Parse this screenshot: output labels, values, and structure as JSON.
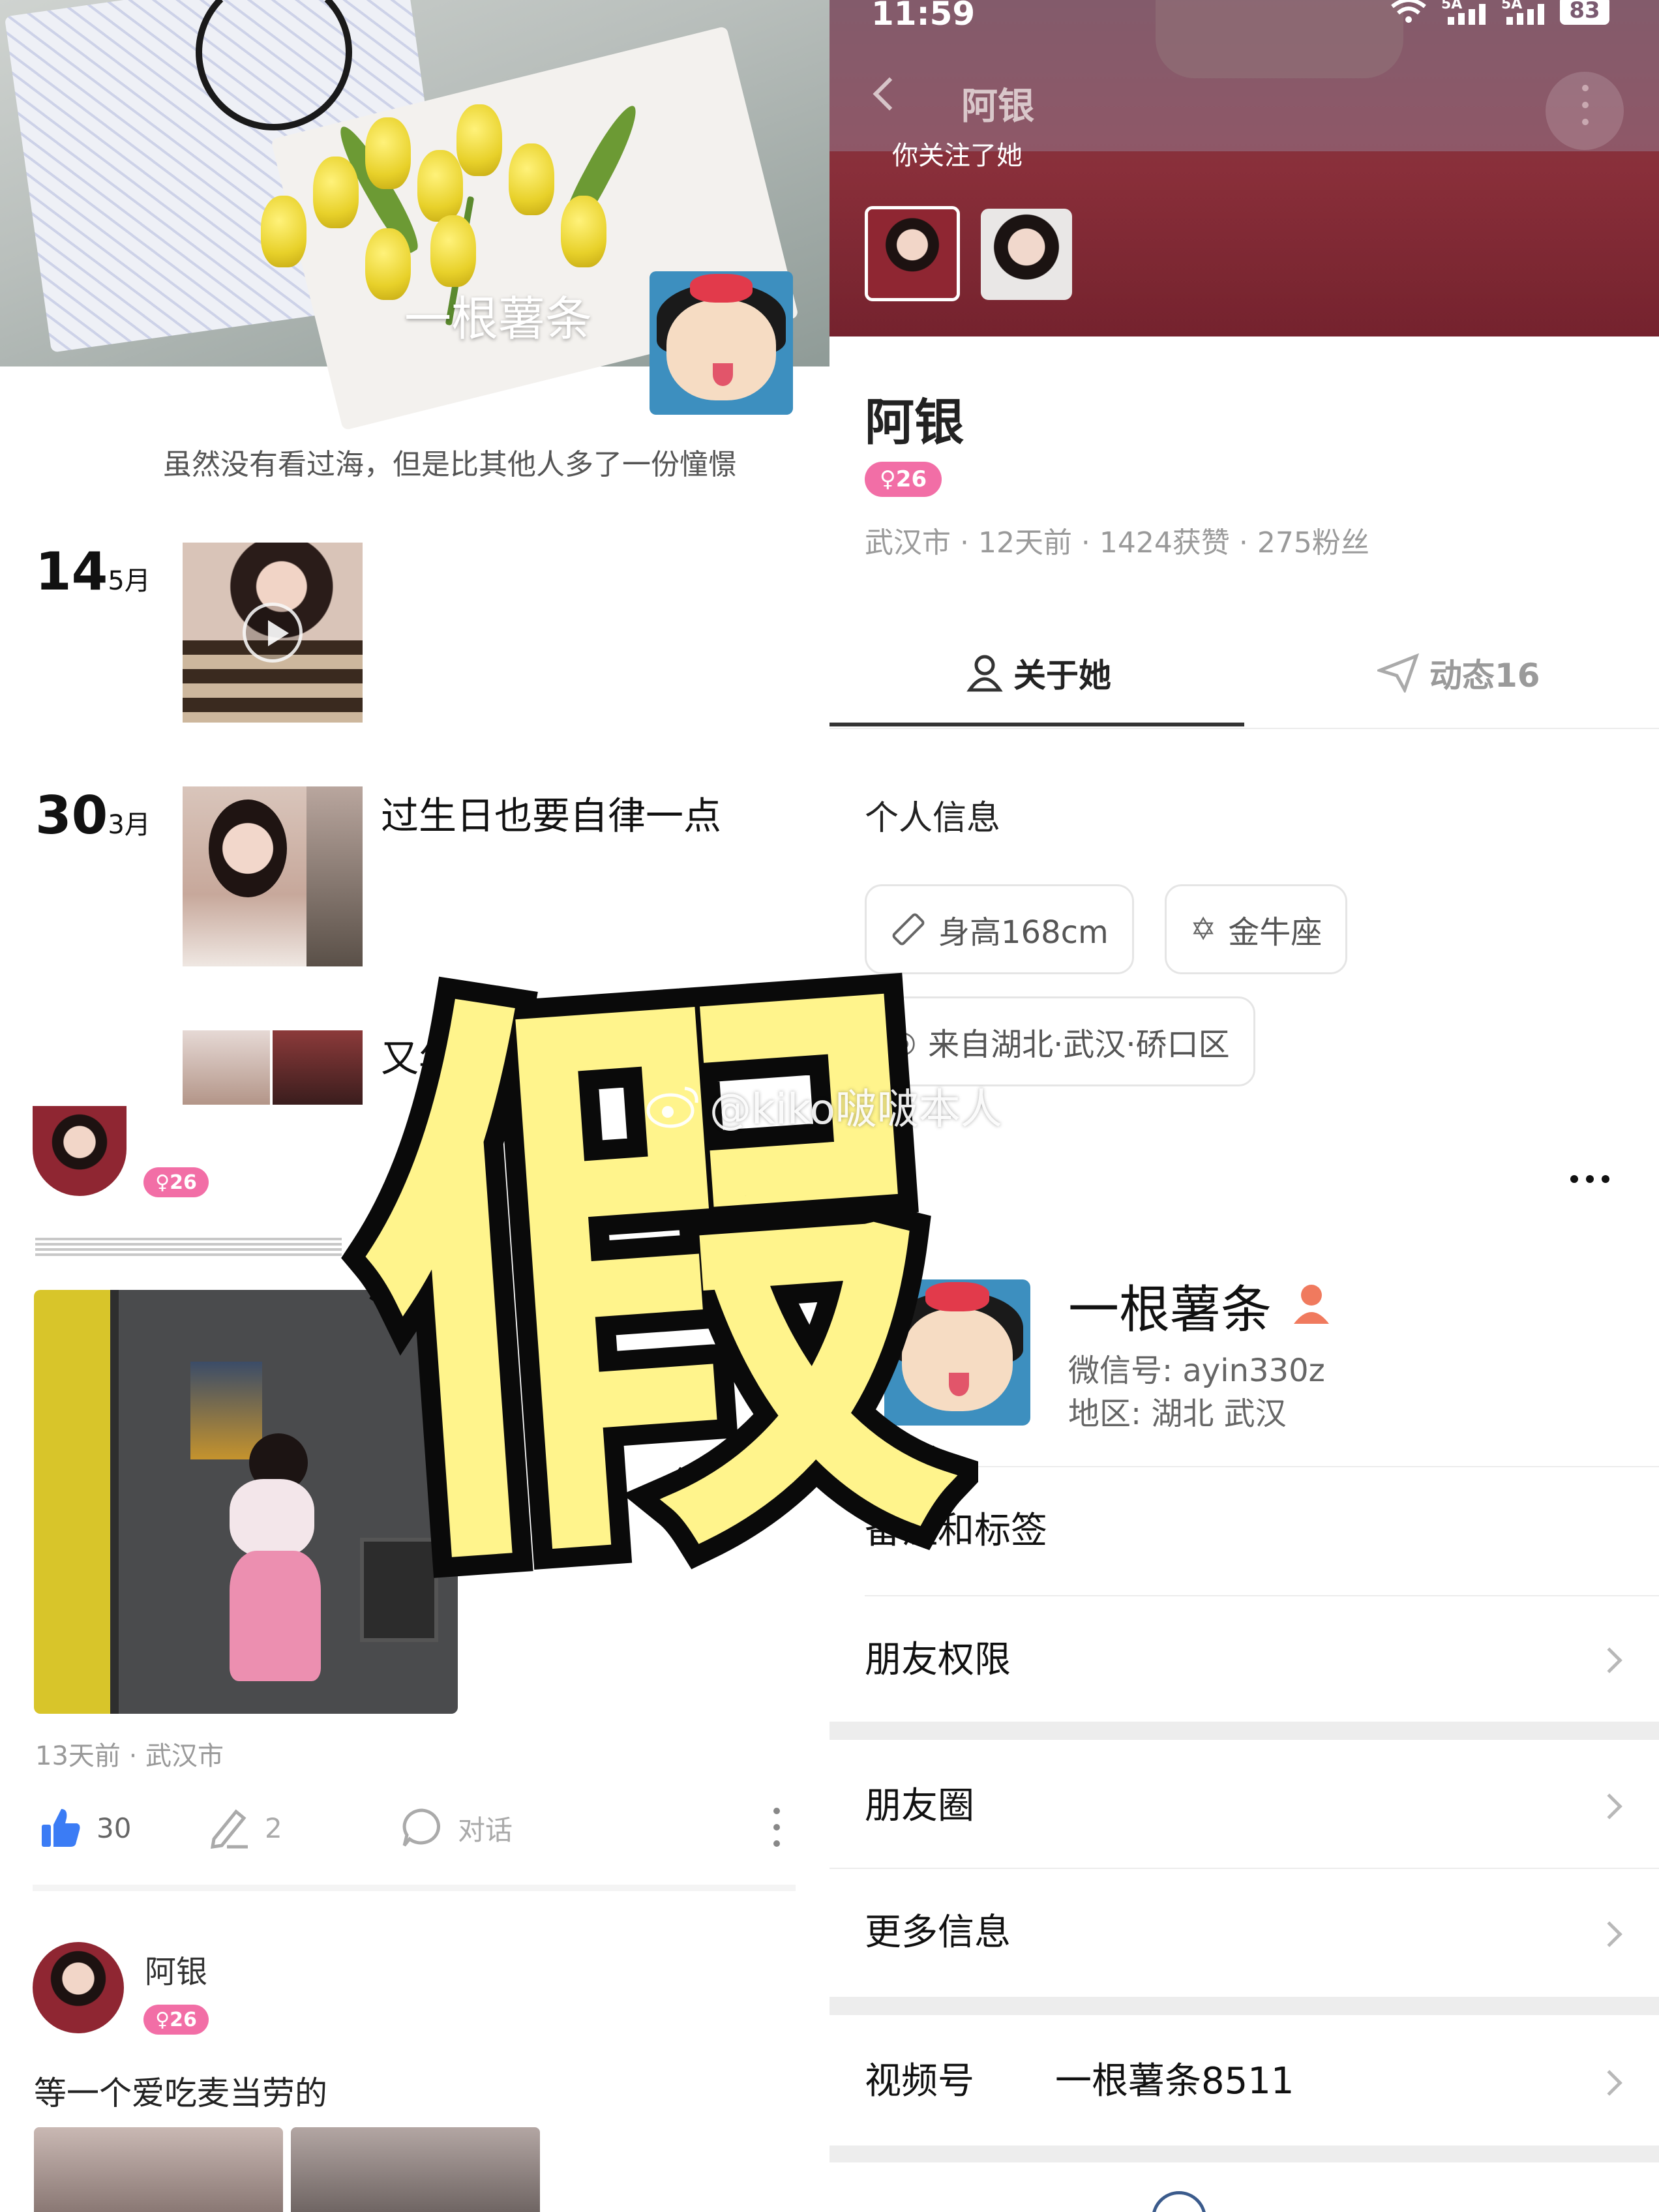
{
  "left_moments": {
    "cover_nickname": "一根薯条",
    "signature": "虽然没有看过海，但是比其他人多了一份憧憬",
    "posts": [
      {
        "day": "14",
        "month": "5月",
        "text": ""
      },
      {
        "day": "30",
        "month": "3月",
        "text": "过生日也要自律一点"
      },
      {
        "day": "",
        "month": "",
        "text": "又年"
      }
    ]
  },
  "profile": {
    "status_time": "11:59",
    "battery": "83",
    "signal_labels": [
      "5A",
      "5A"
    ],
    "nav_title": "阿银",
    "follow_tip": "你关注了她",
    "name": "阿银",
    "age_badge": "26",
    "meta": "武汉市 · 12天前 · 1424获赞 · 275粉丝",
    "tabs": [
      {
        "label": "关于她",
        "active": true
      },
      {
        "label": "动态16",
        "active": false
      }
    ],
    "section_title": "个人信息",
    "chips": [
      "身高168cm",
      "金牛座",
      "来自湖北·武汉·硚口区"
    ],
    "accent_color": "#f26ea6"
  },
  "feed": {
    "age_badge": "26",
    "post_meta": "13天前 · 武汉市",
    "likes": "30",
    "comments": "2",
    "chat_label": "对话",
    "second_post": {
      "name": "阿银",
      "age_badge": "26",
      "text": "等一个爱吃麦当劳的"
    }
  },
  "wechat_card": {
    "more_icon": "more-icon",
    "name": "一根薯条",
    "wechat_id": "微信号: ayin330z",
    "region": "地区: 湖北 武汉",
    "rows": [
      "备注和标签",
      "朋友权限",
      "朋友圈",
      "更多信息"
    ],
    "channel_label": "视频号",
    "channel_value": "一根薯条8511"
  },
  "overlay": {
    "big_char": "假",
    "watermark": "@kiko啵啵本人"
  }
}
